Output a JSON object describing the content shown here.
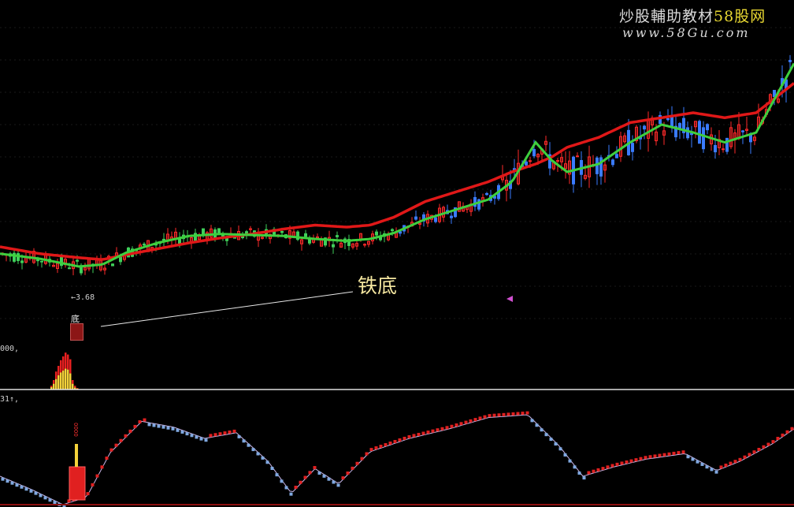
{
  "watermark": {
    "line1_a": "炒股輔助教材",
    "line1_b": "58股网",
    "line2": "www.58Gu.com"
  },
  "annotation": {
    "main_text": "铁底",
    "signal_label": "底",
    "low_price_label": "←3.68"
  },
  "panes": {
    "volume_label": "000,",
    "oscillator_label": "31↑,",
    "oscillator_signal_text": "0000"
  },
  "colors": {
    "up_candle": "#ff2a2a",
    "down_candle": "#3a7bff",
    "down_candle_low": "#3fd05a",
    "ma_red": "#e01818",
    "ma_green": "#3ecf3e",
    "vol_red": "#e82020",
    "vol_yellow": "#f4d23a",
    "osc_up": "#e02020",
    "osc_down": "#7fa8e0",
    "osc_line": "#c9b6e8",
    "separator": "#d9d9d9"
  },
  "chart_data": [
    {
      "type": "line",
      "pane": "price",
      "series": [
        {
          "x": [
            0,
            50,
            100,
            130,
            160,
            200,
            240,
            280,
            320,
            360,
            400,
            440,
            470,
            500,
            540,
            580,
            620,
            650,
            680,
            700,
            720,
            760,
            800,
            840,
            880,
            920,
            960,
            1008
          ],
          "values": [
            37,
            32,
            24,
            26,
            38,
            48,
            55,
            57,
            56,
            55,
            52,
            50,
            52,
            58,
            72,
            82,
            92,
            110,
            150,
            132,
            120,
            128,
            150,
            168,
            160,
            150,
            160,
            230
          ]
        },
        {
          "x": [
            0,
            50,
            100,
            130,
            160,
            200,
            240,
            280,
            320,
            360,
            400,
            440,
            470,
            500,
            540,
            580,
            620,
            650,
            680,
            700,
            720,
            760,
            800,
            840,
            880,
            920,
            960,
            1008
          ],
          "values": [
            44,
            37,
            33,
            31,
            36,
            42,
            48,
            53,
            57,
            62,
            66,
            64,
            66,
            74,
            90,
            100,
            110,
            120,
            128,
            135,
            145,
            155,
            170,
            175,
            180,
            175,
            180,
            210
          ]
        }
      ]
    },
    {
      "type": "bar",
      "pane": "volume",
      "series": [
        {
          "values": [
            8,
            20,
            38,
            50,
            62,
            70,
            78,
            74,
            64,
            20,
            8,
            3
          ]
        },
        {
          "values": [
            5,
            12,
            22,
            30,
            36,
            40,
            44,
            42,
            34,
            12,
            4,
            2
          ]
        }
      ]
    },
    {
      "type": "line",
      "pane": "oscillator",
      "series": [
        {
          "x": [
            0,
            40,
            80,
            110,
            140,
            180,
            220,
            260,
            300,
            340,
            370,
            400,
            430,
            470,
            520,
            570,
            620,
            670,
            710,
            740,
            780,
            820,
            870,
            910,
            940,
            980,
            1008
          ],
          "values": [
            -30,
            -44,
            -60,
            -52,
            -5,
            28,
            22,
            10,
            16,
            -14,
            -48,
            -22,
            -38,
            -4,
            10,
            20,
            32,
            35,
            2,
            -30,
            -20,
            -12,
            -6,
            -24,
            -14,
            4,
            20
          ]
        }
      ]
    }
  ]
}
